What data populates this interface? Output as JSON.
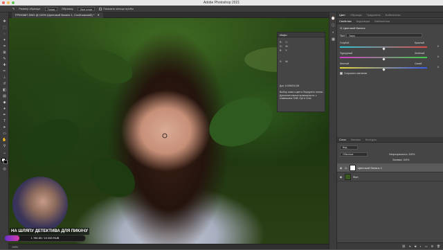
{
  "window": {
    "title": "Adobe Photoshop 2021"
  },
  "options_bar": {
    "sample_size_label": "Размер образца:",
    "sample_size_value": "Точка",
    "sample_label": "Образец:",
    "sample_value": "Все слои",
    "show_ring_label": "Показать кольцо пробы"
  },
  "document": {
    "tab_title": "FP000867.DNG @ 100% (Цветовой баланс 1, Слой-маска/8) *",
    "zoom_status": "100%"
  },
  "overlay": {
    "caption": "НА ШЛЯПУ ДЕТЕКТИВА ДЛЯ ПИКАЧУ",
    "donation_text": "1 780.55 / 10 000 RUB",
    "donation_progress": 0.178
  },
  "info_panel": {
    "title": "Инфо",
    "doc_label": "Док: 6,00M/24,0M",
    "description": "Выбор нового цвета Переднего плана. Дополнительные возможности: с клавишами Shift, Opt и Cmd."
  },
  "right_panel": {
    "top_tabs": [
      "Цвет",
      "Образцы",
      "Градиенты",
      "Библиотеки"
    ],
    "properties_tabs": [
      "Свойства",
      "Коррекция",
      "Библиотеки"
    ],
    "adjustment_name": "Цветовой баланс",
    "tone_label": "Тон:",
    "tone_value": "Тона",
    "sliders": [
      {
        "left": "Голубой",
        "right": "Красный",
        "value": "0",
        "colors": [
          "#2ec6d6",
          "#e24a4a"
        ],
        "level": 0.5
      },
      {
        "left": "Пурпурный",
        "right": "Зелёный",
        "value": "0",
        "colors": [
          "#d83cc9",
          "#3ed04a"
        ],
        "level": 0.5
      },
      {
        "left": "Желтый",
        "right": "Синий",
        "value": "0",
        "colors": [
          "#e8d83a",
          "#3a5ae8"
        ],
        "level": 0.5
      }
    ],
    "preserve_label": "Сохранить свечение",
    "layers_tabs": [
      "Слои",
      "Каналы",
      "Контуры"
    ],
    "kind_label": "Вид",
    "opacity_label": "Непрозрачность:",
    "opacity_value": "100%",
    "fill_label": "Заливка:",
    "fill_value": "100%",
    "blend_mode": "Обычные",
    "layers": [
      {
        "name": "Цветовой баланс 1"
      },
      {
        "name": "Фон"
      }
    ]
  }
}
